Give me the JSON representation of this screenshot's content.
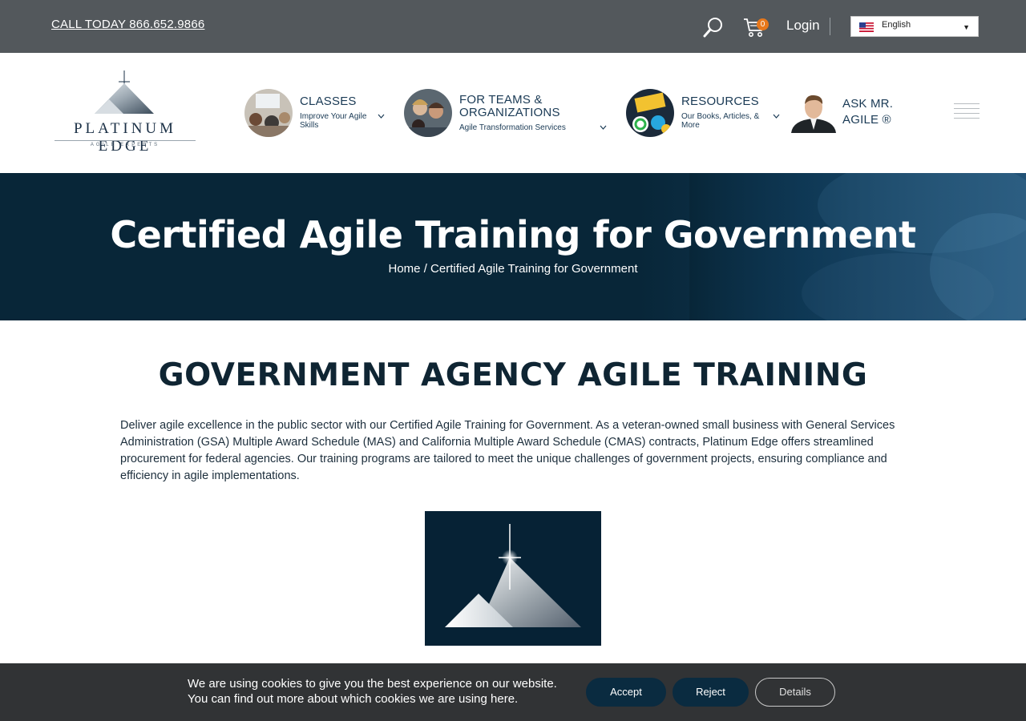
{
  "topbar": {
    "call_label": "CALL TODAY 866.652.9866",
    "cart_count": "0",
    "login_label": "Login",
    "language": "English"
  },
  "brand": {
    "name": "PLATINUM EDGE",
    "tagline": "AGILE EXPERTS"
  },
  "nav": {
    "items": [
      {
        "title": "CLASSES",
        "subtitle": "Improve Your Agile Skills",
        "icon": "chevron-down-icon"
      },
      {
        "title": "FOR TEAMS & ORGANIZATIONS",
        "subtitle": "Agile Transformation Services",
        "icon": "chevron-down-icon"
      },
      {
        "title": "RESOURCES",
        "subtitle": "Our Books, Articles, & More",
        "icon": "chevron-down-icon"
      },
      {
        "title": "ASK MR. AGILE ®",
        "subtitle": "",
        "icon": ""
      }
    ],
    "menu_icon": "hamburger-menu-icon"
  },
  "hero": {
    "title": "Certified Agile Training for Government",
    "breadcrumb_home": "Home",
    "breadcrumb_separator": "/",
    "breadcrumb_current": "Certified Agile Training for Government"
  },
  "main": {
    "section_title": "GOVERNMENT AGENCY AGILE TRAINING",
    "intro": "Deliver agile excellence in the public sector with our Certified Agile Training for Government. As a veteran-owned small business with General Services Administration (GSA) Multiple Award Schedule (MAS) and California Multiple Award Schedule (CMAS) contracts, Platinum Edge offers streamlined procurement for federal agencies. Our training programs are tailored to meet the unique challenges of government projects, ensuring compliance and efficiency in agile implementations."
  },
  "cookie": {
    "line1": "We are using cookies to give you the best experience on our website.",
    "line2_prefix": "You can find out more about which cookies we are using ",
    "line2_link": "here",
    "line2_suffix": ".",
    "accept_label": "Accept",
    "reject_label": "Reject",
    "details_label": "Details"
  },
  "colors": {
    "topbar": "#53585c",
    "hero": "#082638",
    "accent_orange": "#e8781b",
    "button_navy": "#0a2b40",
    "cookie_bar": "#313335"
  }
}
